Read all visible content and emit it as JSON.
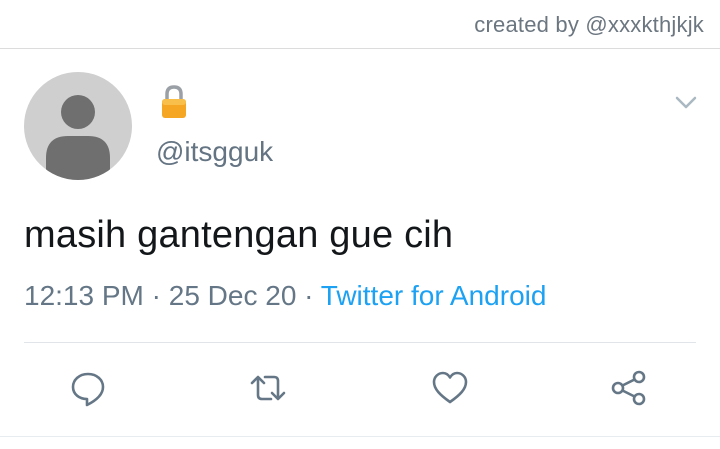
{
  "header": {
    "credit": "created by @xxxkthjkjk"
  },
  "tweet": {
    "handle": "@itsgguk",
    "text": "masih gantengan gue cih",
    "time": "12:13 PM",
    "date": "25 Dec 20",
    "separator": "·",
    "source": "Twitter for Android",
    "protected": true
  },
  "icons": {
    "lock": "lock-icon",
    "menu": "chevron-down-icon",
    "reply": "reply-icon",
    "retweet": "retweet-icon",
    "like": "heart-icon",
    "share": "share-icon"
  },
  "colors": {
    "link": "#1da1f2",
    "muted": "#657786",
    "text": "#14171a",
    "lock": "#f5a623"
  }
}
